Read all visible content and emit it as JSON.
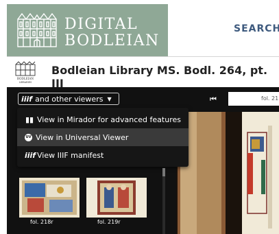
{
  "header": {
    "logo_line1": "DIGITAL",
    "logo_line2": "BODLEIAN",
    "search_label": "SEARCH",
    "brand_color": "#8fa896"
  },
  "manuscript": {
    "title": "Bodleian Library MS. Bodl. 264, pt. III",
    "library_logo_line1": "BODLEIAN",
    "library_logo_line2": "LIBRARIES"
  },
  "viewer": {
    "viewers_button_label": "and other viewers",
    "page_field_value": "fol. 21",
    "menu": [
      {
        "label": "View in Mirador for advanced features",
        "icon": "mirador-icon"
      },
      {
        "label": "View in Universal Viewer",
        "icon": "universal-viewer-icon",
        "icon_text": "UV",
        "highlighted": true
      },
      {
        "label": "View IIIF manifest",
        "icon": "iiif-icon"
      }
    ],
    "thumbnails": [
      {
        "label": "fol. 218r"
      },
      {
        "label": "fol. 219r"
      }
    ]
  }
}
